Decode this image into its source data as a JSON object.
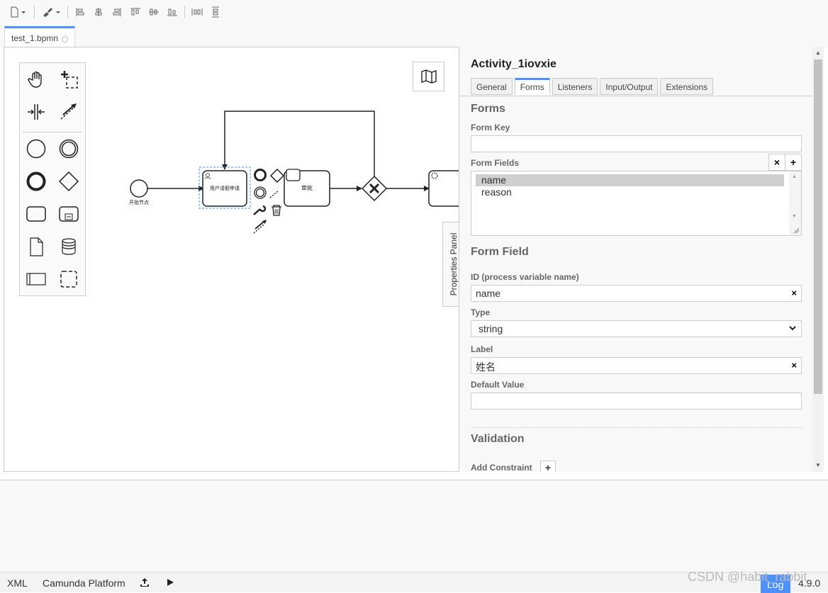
{
  "tab": {
    "title": "test_1.bpmn"
  },
  "diagram": {
    "start_event_label": "开始节点",
    "task1_label": "用户请假申请",
    "task2_label": "审批"
  },
  "properties_toggle": {
    "label": "Properties Panel"
  },
  "panel": {
    "title": "Activity_1iovxie",
    "tabs": [
      "General",
      "Forms",
      "Listeners",
      "Input/Output",
      "Extensions"
    ],
    "active_tab": "Forms",
    "forms_heading": "Forms",
    "form_key_label": "Form Key",
    "form_key_value": "",
    "form_fields_label": "Form Fields",
    "form_fields": [
      "name",
      "reason"
    ],
    "selected_field": "name",
    "form_field_heading": "Form Field",
    "id_label": "ID (process variable name)",
    "id_value": "name",
    "type_label": "Type",
    "type_value": "string",
    "label_label": "Label",
    "label_value": "姓名",
    "default_value_label": "Default Value",
    "default_value": "",
    "validation_heading": "Validation",
    "add_constraint_label": "Add Constraint"
  },
  "statusbar": {
    "xml": "XML",
    "platform": "Camunda Platform",
    "log": "Log",
    "version": "4.9.0"
  },
  "watermark": "CSDN @habit_rabbit",
  "colors": {
    "accent": "#4d90fe",
    "selection_outline": "#4d90fe"
  }
}
